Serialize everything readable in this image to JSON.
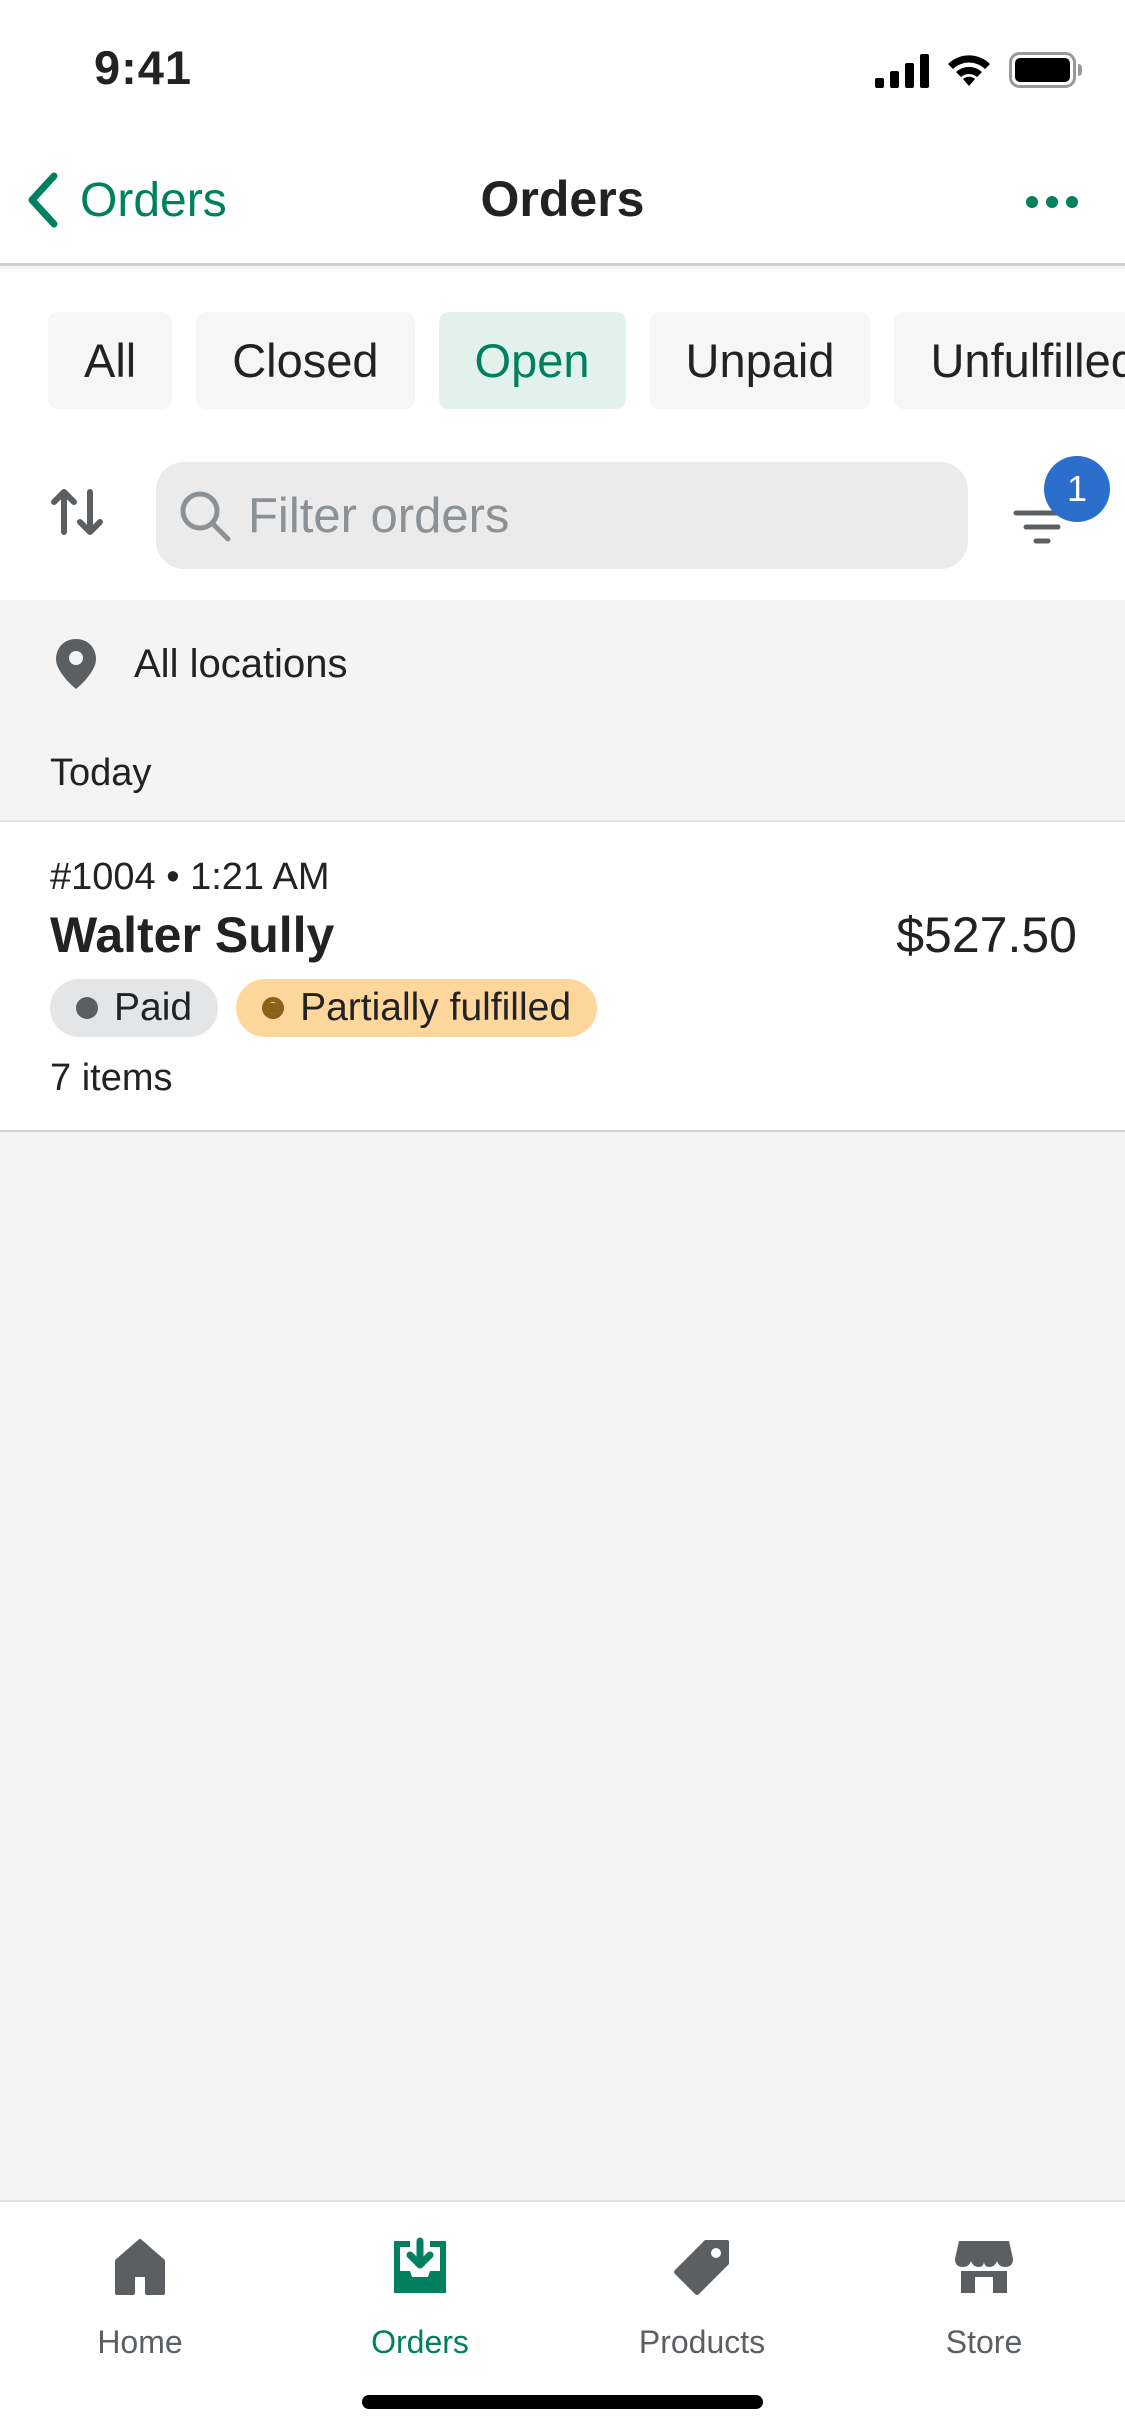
{
  "status_bar": {
    "time": "9:41"
  },
  "nav": {
    "back_label": "Orders",
    "title": "Orders"
  },
  "tabs": [
    {
      "label": "All",
      "active": false
    },
    {
      "label": "Closed",
      "active": false
    },
    {
      "label": "Open",
      "active": true
    },
    {
      "label": "Unpaid",
      "active": false
    },
    {
      "label": "Unfulfilled",
      "active": false
    }
  ],
  "search": {
    "placeholder": "Filter orders",
    "value": ""
  },
  "filter": {
    "badge_count": "1"
  },
  "location": {
    "label": "All locations"
  },
  "section": {
    "label": "Today"
  },
  "orders": [
    {
      "meta": "#1004 • 1:21 AM",
      "customer": "Walter Sully",
      "total": "$527.50",
      "payment_status": "Paid",
      "fulfillment_status": "Partially fulfilled",
      "items": "7 items"
    }
  ],
  "bottom_nav": [
    {
      "label": "Home",
      "icon": "home-icon",
      "active": false
    },
    {
      "label": "Orders",
      "icon": "orders-icon",
      "active": true
    },
    {
      "label": "Products",
      "icon": "tag-icon",
      "active": false
    },
    {
      "label": "Store",
      "icon": "store-icon",
      "active": false
    }
  ],
  "colors": {
    "accent": "#00805f",
    "badge_blue": "#2c6ecb",
    "partial_badge": "#ffd79d"
  }
}
